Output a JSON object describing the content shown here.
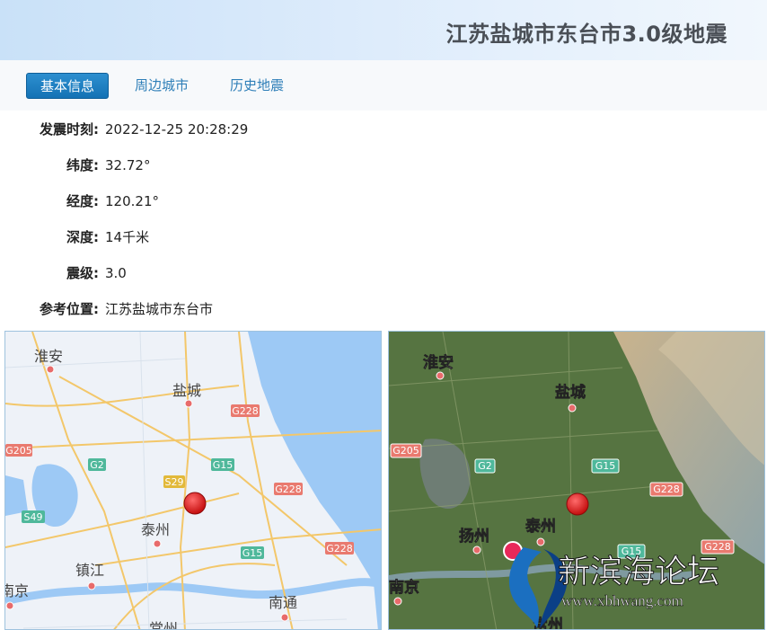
{
  "header": {
    "title": "江苏盐城市东台市3.0级地震"
  },
  "tabs": [
    {
      "label": "基本信息",
      "active": true
    },
    {
      "label": "周边城市",
      "active": false
    },
    {
      "label": "历史地震",
      "active": false
    }
  ],
  "info": {
    "time_label": "发震时刻:",
    "time_value": "2022-12-25 20:28:29",
    "lat_label": "纬度:",
    "lat_value": "32.72°",
    "lon_label": "经度:",
    "lon_value": "120.21°",
    "depth_label": "深度:",
    "depth_value": "14千米",
    "mag_label": "震级:",
    "mag_value": "3.0",
    "place_label": "参考位置:",
    "place_value": "江苏盐城市东台市"
  },
  "map_road": {
    "cities": [
      "淮安",
      "盐城",
      "泰州",
      "镇江",
      "南京",
      "南通",
      "常州"
    ],
    "highways": [
      "G205",
      "G228",
      "G2",
      "G15",
      "S29",
      "S49",
      "G228",
      "G15",
      "G228"
    ]
  },
  "map_satellite": {
    "cities": [
      "淮安",
      "盐城",
      "扬州",
      "泰州",
      "南京",
      "常州"
    ],
    "highways": [
      "G205",
      "G2",
      "G15",
      "G228",
      "G15",
      "G228"
    ]
  },
  "watermark": {
    "name": "新滨海论坛",
    "url": "www.xbhwang.com"
  },
  "colors": {
    "accent": "#1a78be",
    "epicenter": "#e01818",
    "water": "#9dc9f5",
    "land": "#eef2f8"
  }
}
